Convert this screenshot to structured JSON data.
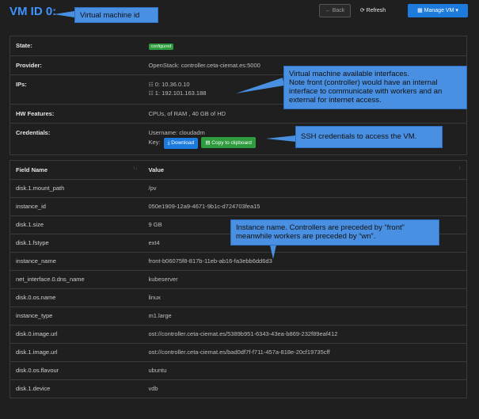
{
  "header": {
    "title": "VM ID 0:",
    "back_label": "Back",
    "refresh_label": "Refresh",
    "manage_label": "Manage VM"
  },
  "info": {
    "state_label": "State:",
    "state_value": "configured",
    "provider_label": "Provider:",
    "provider_value": "OpenStack: controller.ceta-ciemat.es:5000",
    "ips_label": "IPs:",
    "ip0": "0: 10.36.0.10",
    "ip1": "1: 192.101.163.188",
    "hw_label": "HW Features:",
    "hw_value": "CPUs, of RAM , 40 GB of HD",
    "cred_label": "Credentials:",
    "username": "Username: cloudadm",
    "key_label": "Key:",
    "download_label": "Download",
    "copy_label": "Copy to clipboard"
  },
  "fields": {
    "col_name": "Field Name",
    "col_value": "Value",
    "rows": [
      {
        "name": "disk.1.mount_path",
        "value": "/pv"
      },
      {
        "name": "instance_id",
        "value": "050e1909-12a9-4671-9b1c-d724703fea15"
      },
      {
        "name": "disk.1.size",
        "value": "9 GB"
      },
      {
        "name": "disk.1.fstype",
        "value": "ext4"
      },
      {
        "name": "instance_name",
        "value": "front-b06075f8-817b-11eb-ab16-fa3ebb6dd6d3"
      },
      {
        "name": "net_interface.0.dns_name",
        "value": "kubeserver"
      },
      {
        "name": "disk.0.os.name",
        "value": "linux"
      },
      {
        "name": "instance_type",
        "value": "m1.large"
      },
      {
        "name": "disk.0.image.url",
        "value": "ost://controller.ceta-ciemat.es/5389b951-6343-43ea-b869-232f89eaf412"
      },
      {
        "name": "disk.1.image.url",
        "value": "ost://controller.ceta-ciemat.es/bad0df7f-f711-457a-818e-20cf19735cff"
      },
      {
        "name": "disk.0.os.flavour",
        "value": "ubuntu"
      },
      {
        "name": "disk.1.device",
        "value": "vdb"
      }
    ]
  },
  "callouts": {
    "vm_id": "Virtual machine id",
    "interfaces": "Virtual machine available interfaces.\nNote front (controller) would have an internal interface to communicate with workers and an external for internet access.",
    "ssh": "SSH credentials to access the VM.",
    "instance_name": "Instance name. Controllers are preceded by “front” meanwhile workers are preceded by “wn”."
  },
  "colors": {
    "accent": "#1e7bde",
    "success": "#2e9b3e",
    "callout": "#4a90e2",
    "title": "#3f95ff"
  }
}
